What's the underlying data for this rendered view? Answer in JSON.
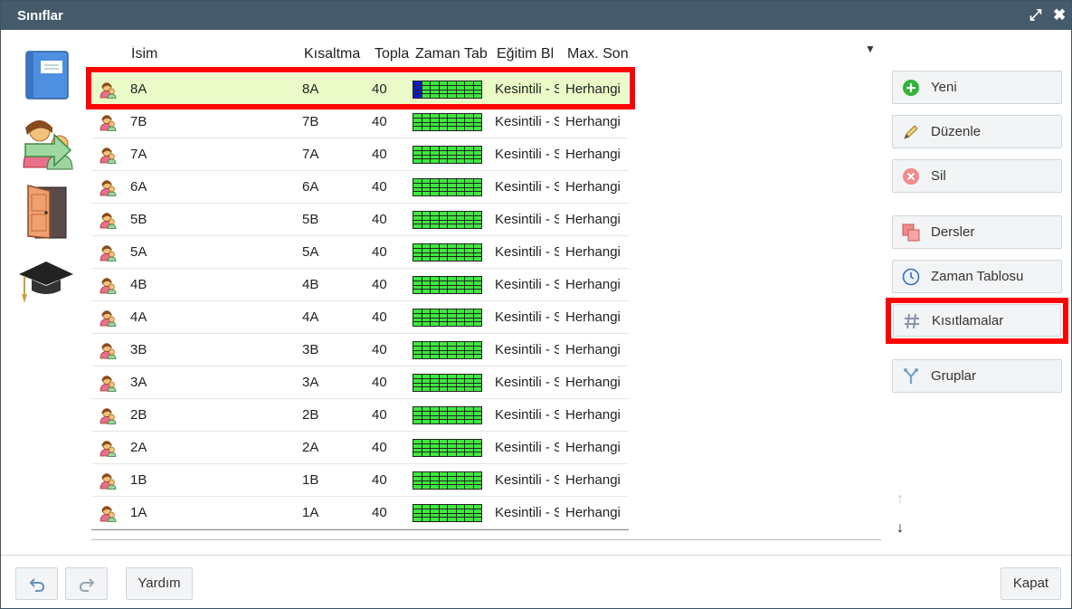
{
  "window": {
    "title": "Sınıflar"
  },
  "columns": {
    "name": "İsim",
    "short": "Kısaltma",
    "total": "Topla",
    "timetable": "Zaman Tab",
    "education": "Eğitim Bl",
    "max": "Max. Son"
  },
  "rows": [
    {
      "name": "8A",
      "short": "8A",
      "total": "40",
      "education": "Kesintili - S",
      "max": "Herhangi",
      "selected": true
    },
    {
      "name": "7B",
      "short": "7B",
      "total": "40",
      "education": "Kesintili - S",
      "max": "Herhangi"
    },
    {
      "name": "7A",
      "short": "7A",
      "total": "40",
      "education": "Kesintili - S",
      "max": "Herhangi"
    },
    {
      "name": "6A",
      "short": "6A",
      "total": "40",
      "education": "Kesintili - S",
      "max": "Herhangi"
    },
    {
      "name": "5B",
      "short": "5B",
      "total": "40",
      "education": "Kesintili - S",
      "max": "Herhangi"
    },
    {
      "name": "5A",
      "short": "5A",
      "total": "40",
      "education": "Kesintili - S",
      "max": "Herhangi"
    },
    {
      "name": "4B",
      "short": "4B",
      "total": "40",
      "education": "Kesintili - S",
      "max": "Herhangi"
    },
    {
      "name": "4A",
      "short": "4A",
      "total": "40",
      "education": "Kesintili - S",
      "max": "Herhangi"
    },
    {
      "name": "3B",
      "short": "3B",
      "total": "40",
      "education": "Kesintili - S",
      "max": "Herhangi"
    },
    {
      "name": "3A",
      "short": "3A",
      "total": "40",
      "education": "Kesintili - S",
      "max": "Herhangi"
    },
    {
      "name": "2B",
      "short": "2B",
      "total": "40",
      "education": "Kesintili - S",
      "max": "Herhangi"
    },
    {
      "name": "2A",
      "short": "2A",
      "total": "40",
      "education": "Kesintili - S",
      "max": "Herhangi"
    },
    {
      "name": "1B",
      "short": "1B",
      "total": "40",
      "education": "Kesintili - S",
      "max": "Herhangi"
    },
    {
      "name": "1A",
      "short": "1A",
      "total": "40",
      "education": "Kesintili - S",
      "max": "Herhangi"
    }
  ],
  "actions": {
    "new": "Yeni",
    "edit": "Düzenle",
    "delete": "Sil",
    "lessons": "Dersler",
    "timetable": "Zaman Tablosu",
    "constraints": "Kısıtlamalar",
    "groups": "Gruplar"
  },
  "footer": {
    "help": "Yardım",
    "close": "Kapat"
  },
  "colors": {
    "titlebar": "#455a6a",
    "selected_row": "#eafbc8",
    "highlight": "#ff0000",
    "timetable_free": "#3ce93c",
    "timetable_marked": "#0a1cc9"
  }
}
